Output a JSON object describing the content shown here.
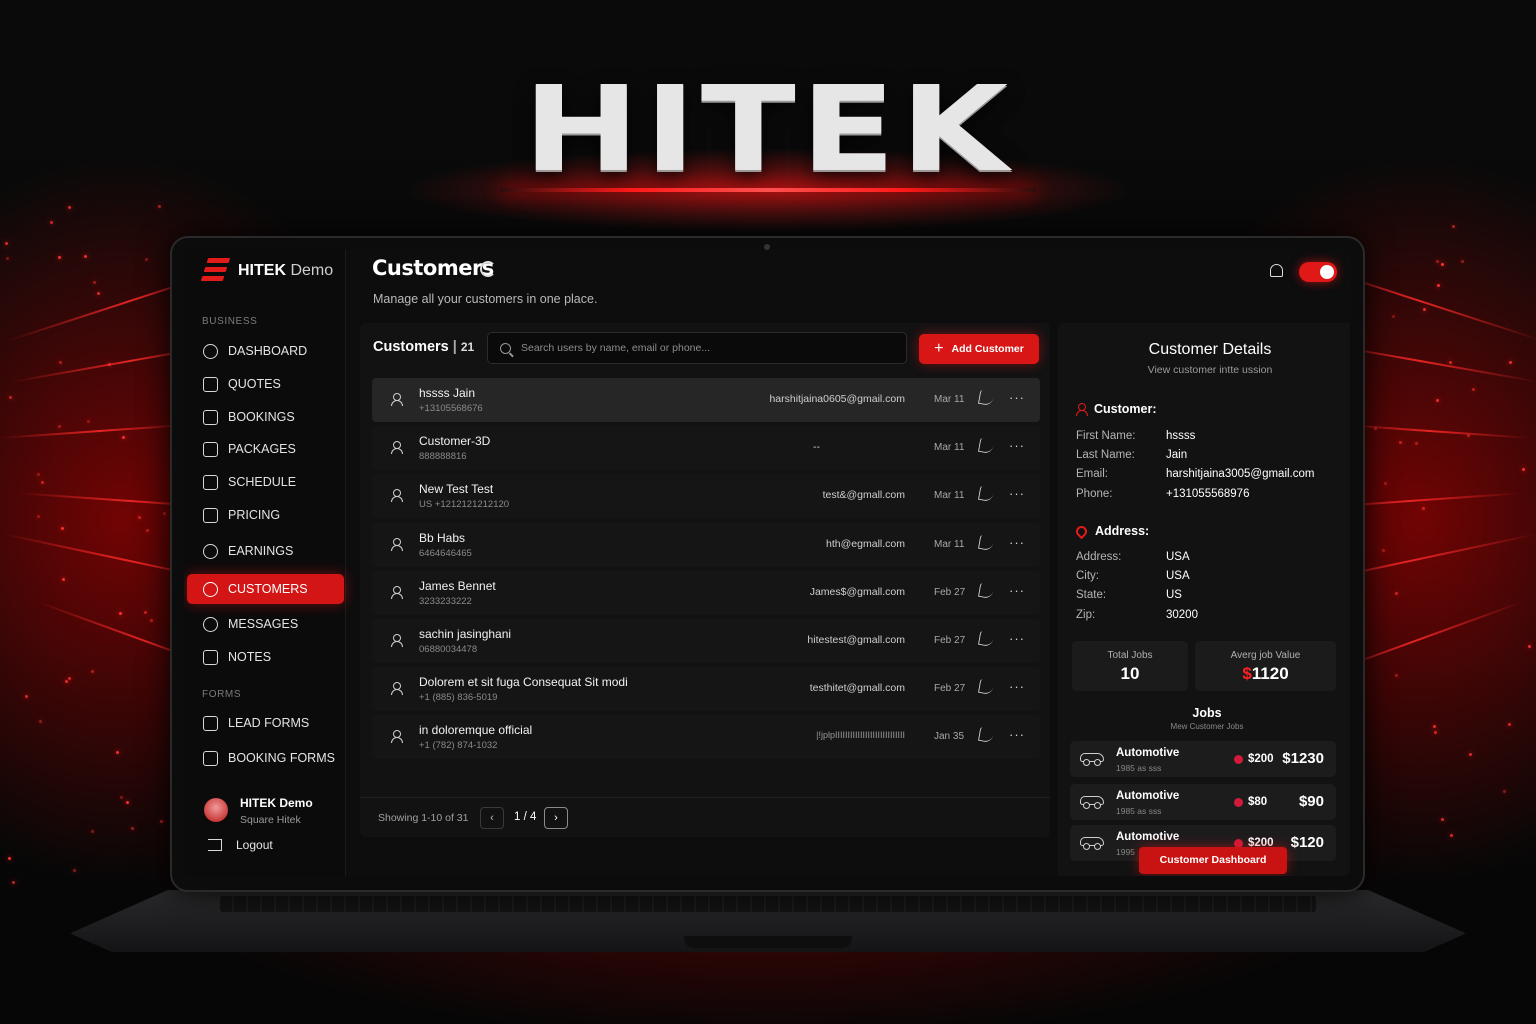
{
  "hero": {
    "logo": "HITEK"
  },
  "colors": {
    "accent": "#d91616",
    "background": "#0d0d0e",
    "panel": "#121213"
  },
  "sidebar": {
    "brand": {
      "name": "HITEK",
      "suffix": "Demo"
    },
    "sections": {
      "business": "BUSINESS",
      "forms": "FORMS"
    },
    "items": [
      {
        "label": "DASHBOARD",
        "icon": "dashboard-icon"
      },
      {
        "label": "QUOTES",
        "icon": "quotes-icon"
      },
      {
        "label": "BOOKINGS",
        "icon": "bookings-icon"
      },
      {
        "label": "PACKAGES",
        "icon": "packages-icon"
      },
      {
        "label": "SCHEDULE",
        "icon": "calendar-icon"
      },
      {
        "label": "PRICING",
        "icon": "pricing-icon"
      },
      {
        "label": "EARNINGS",
        "icon": "earnings-icon"
      },
      {
        "label": "CUSTOMERS",
        "icon": "customers-icon",
        "active": true
      },
      {
        "label": "MESSAGES",
        "icon": "messages-icon"
      },
      {
        "label": "NOTES",
        "icon": "notes-icon"
      }
    ],
    "form_items": [
      {
        "label": "LEAD FORMS",
        "icon": "clipboard-icon"
      },
      {
        "label": "BOOKING FORMS",
        "icon": "form-icon"
      }
    ],
    "user": {
      "name": "HITEK Demo",
      "sub": "Square Hitek"
    },
    "logout": "Logout"
  },
  "header": {
    "title": "Customers",
    "subtitle": "Manage all your customers in one place."
  },
  "customers": {
    "label": "Customers",
    "count": "21",
    "search_placeholder": "Search users by name, email or phone...",
    "add_button": "Add Customer",
    "rows": [
      {
        "name": "hssss Jain",
        "phone": "+13105568676",
        "email": "harshitjaina0605@gmail.com",
        "date": "Mar 11"
      },
      {
        "name": "Customer-3D",
        "phone": "888888816",
        "email": "--",
        "date": "Mar 11"
      },
      {
        "name": "New Test Test",
        "phone": "US +1212121212120",
        "email": "test&@gmall.com",
        "date": "Mar 11"
      },
      {
        "name": "Bb Habs",
        "phone": "6464646465",
        "email": "hth@egmall.com",
        "date": "Mar 11"
      },
      {
        "name": "James Bennet",
        "phone": "3233233222",
        "email": "James$@gmall.com",
        "date": "Feb 27"
      },
      {
        "name": "sachin jasinghani",
        "phone": "06880034478",
        "email": "hitestest@gmall.com",
        "date": "Feb 27"
      },
      {
        "name": "Dolorem et sit fuga Consequat Sit modi",
        "phone": "+1 (885) 836-5019",
        "email": "testhitet@gmall.com",
        "date": "Feb 27"
      },
      {
        "name": "in doloremque official",
        "phone": "+1 (782) 874-1032",
        "email": "|!jplpIIIIIIIIIIIIIIIIIIIIIIIIIIII",
        "date": "Jan 35"
      }
    ],
    "pagination": {
      "showing": "Showing 1-10 of 31",
      "page": "1 / 4",
      "prev": "‹",
      "next": "›"
    }
  },
  "details": {
    "title": "Customer Details",
    "subtitle": "View customer intte ussion",
    "customer_heading": "Customer:",
    "customer_fields": [
      {
        "key": "First Name:",
        "value": "hssss"
      },
      {
        "key": "Last Name:",
        "value": "Jain"
      },
      {
        "key": "Email:",
        "value": "harshitjaina3005@gmail.com"
      },
      {
        "key": "Phone:",
        "value": "+131055568976"
      }
    ],
    "address_heading": "Address:",
    "address_fields": [
      {
        "key": "Address:",
        "value": "USA"
      },
      {
        "key": "City:",
        "value": "USA"
      },
      {
        "key": "State:",
        "value": "US"
      },
      {
        "key": "Zip:",
        "value": "30200"
      }
    ],
    "stats": {
      "total_jobs_label": "Total Jobs",
      "total_jobs": "10",
      "avg_label": "Averg job Value",
      "avg_currency": "$",
      "avg_value": "1120"
    },
    "jobs_title": "Jobs",
    "jobs_sub": "Mew Customer Jobs",
    "jobs": [
      {
        "name": "Automotive",
        "meta": "1985 as sss",
        "price": "$200",
        "total": "$1230"
      },
      {
        "name": "Automotive",
        "meta": "1985 as sss",
        "price": "$80",
        "total": "$90"
      },
      {
        "name": "Automotive",
        "meta": "1995",
        "price": "$200",
        "total": "$120"
      }
    ],
    "dashboard_button": "Customer Dashboard"
  }
}
